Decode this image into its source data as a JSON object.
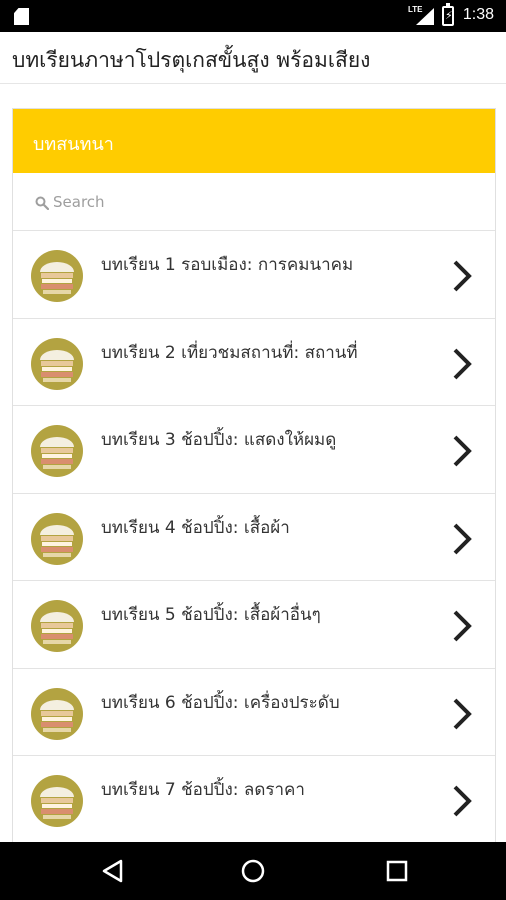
{
  "status_bar": {
    "network": "LTE",
    "time": "1:38"
  },
  "app_bar": {
    "title": "บทเรียนภาษาโปรตุเกสขั้นสูง พร้อมเสียง"
  },
  "card": {
    "header": "บทสนทนา",
    "search_placeholder": "Search"
  },
  "lessons": [
    {
      "label": "บทเรียน 1 รอบเมือง: การคมนาคม"
    },
    {
      "label": "บทเรียน 2 เที่ยวชมสถานที่: สถานที่"
    },
    {
      "label": "บทเรียน 3 ช้อปปิ้ง: แสดงให้ผมดู"
    },
    {
      "label": "บทเรียน 4 ช้อปปิ้ง: เสื้อผ้า"
    },
    {
      "label": "บทเรียน 5 ช้อปปิ้ง: เสื้อผ้าอื่นๆ"
    },
    {
      "label": "บทเรียน 6 ช้อปปิ้ง: เครื่องประดับ"
    },
    {
      "label": "บทเรียน 7 ช้อปปิ้ง: ลดราคา"
    }
  ],
  "colors": {
    "accent": "#ffcc00",
    "book_icon_bg": "#b3a341"
  },
  "icons": [
    "sd-card-icon",
    "signal-icon",
    "battery-icon",
    "search-icon",
    "book-icon",
    "chevron-right-icon",
    "back-icon",
    "home-icon",
    "recents-icon"
  ]
}
